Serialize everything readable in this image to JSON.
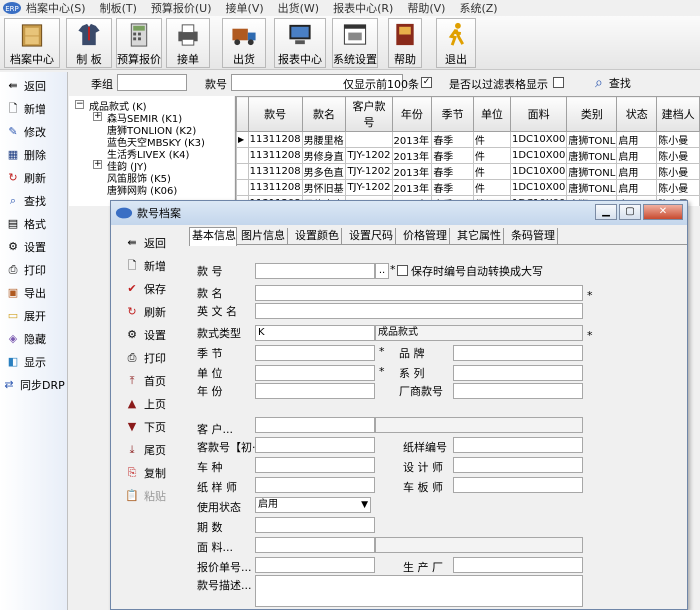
{
  "menubar": {
    "items": [
      "档案中心(S)",
      "制板(T)",
      "预算报价(U)",
      "接单(V)",
      "出货(W)",
      "报表中心(R)",
      "帮助(V)",
      "系统(Z)"
    ]
  },
  "toolbar": {
    "buttons": [
      "档案中心",
      "制 板",
      "预算报价",
      "接单",
      "出货",
      "报表中心",
      "系统设置",
      "帮助",
      "退出"
    ]
  },
  "leftnav": {
    "items": [
      "返回",
      "新增",
      "修改",
      "删除",
      "刷新",
      "查找",
      "格式",
      "设置",
      "打印",
      "导出",
      "展开",
      "隐藏",
      "显示",
      "同步DRP"
    ]
  },
  "filter": {
    "season_label": "季组",
    "season_value": "",
    "code_label": "款号",
    "code_value": "",
    "top100_label": "仅显示前100条",
    "top100_checked": "✓",
    "filter_label": "是否以过滤表格显示",
    "search_label": "查找"
  },
  "tree": {
    "root": "成品款式 (K)",
    "nodes": [
      "森马SEMIR (K1)",
      "唐狮TONLION (K2)",
      "蓝色天空MBSKY (K3)",
      "生活秀LIVEX (K4)",
      "佳韵 (JY)",
      "风笛服饰 (K5)",
      "唐狮网购 (K06)"
    ]
  },
  "grid": {
    "columns": [
      "款号",
      "款名",
      "客户款号",
      "年份",
      "季节",
      "单位",
      "面料",
      "类别",
      "状态",
      "建档人"
    ],
    "rows": [
      [
        "11311208",
        "男腰里格",
        "",
        "2013年",
        "春季",
        "件",
        "1DC10X00",
        "唐狮TONL",
        "启用",
        "陈小曼"
      ],
      [
        "11311208",
        "男修身直",
        "TJY-1202",
        "2013年",
        "春季",
        "件",
        "1DC10X00",
        "唐狮TONL",
        "启用",
        "陈小曼"
      ],
      [
        "11311208",
        "男多色直",
        "TJY-1202",
        "2013年",
        "春季",
        "件",
        "1DC10X00",
        "唐狮TONL",
        "启用",
        "陈小曼"
      ],
      [
        "11311208",
        "男怀旧基",
        "TJY-1202",
        "2013年",
        "春季",
        "件",
        "1DC10X00",
        "唐狮TONL",
        "启用",
        "陈小曼"
      ],
      [
        "11311208",
        "男修身直",
        "",
        "2013年",
        "春季",
        "件",
        "1DC10X00",
        "唐狮TONL",
        "启用",
        "陈小曼"
      ]
    ]
  },
  "dialog": {
    "title": "款号档案",
    "nav": [
      "返回",
      "新增",
      "保存",
      "刷新",
      "设置",
      "打印",
      "首页",
      "上页",
      "下页",
      "尾页",
      "复制",
      "粘贴"
    ],
    "tabs": [
      "基本信息",
      "图片信息",
      "设置颜色",
      "设置尺码",
      "价格管理",
      "其它属性",
      "条码管理"
    ],
    "form": {
      "code": "款      号",
      "code_btn": "..",
      "uppercase_label": "保存时编号自动转换成大写",
      "name": "款      名",
      "en_name": "英 文 名",
      "style_type": "款式类型",
      "style_type_code": "K",
      "style_type_value": "成品款式",
      "season": "季      节",
      "brand": "品      牌",
      "unit": "单      位",
      "series": "系      列",
      "year": "年      份",
      "factory_code": "厂商款号",
      "customer": "客      户...",
      "customer_code": "客款号【初·",
      "paper_code": "纸样编号",
      "category": "车      种",
      "designer": "设 计 师",
      "pattern_maker": "纸 样 师",
      "plate_maker": "车 板 师",
      "status": "使用状态",
      "status_value": "启用",
      "qty": "期      数",
      "fabric": "面      料...",
      "quote_no": "报价单号...",
      "manufacturer": "生 产 厂",
      "desc": "款号描述..."
    },
    "star": "*"
  }
}
